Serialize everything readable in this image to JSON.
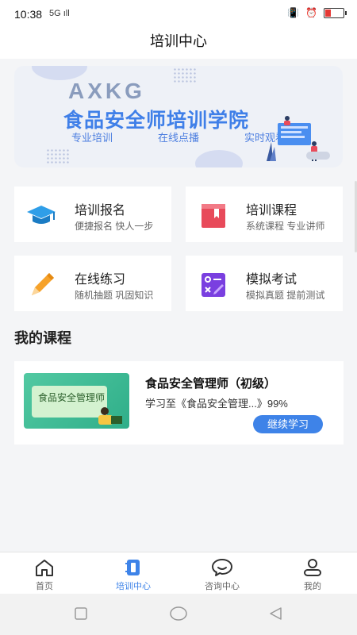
{
  "status_bar": {
    "time": "10:38",
    "signal": "5G ıll"
  },
  "header": {
    "title": "培训中心"
  },
  "banner": {
    "logo": "AXKG",
    "title": "食品安全师培训学院",
    "tags": [
      "专业培训",
      "在线点播",
      "实时观看"
    ]
  },
  "menu": [
    {
      "title": "培训报名",
      "subtitle": "便捷报名 快人一步",
      "icon": "graduation-cap-icon",
      "color": "#2f9ee8"
    },
    {
      "title": "培训课程",
      "subtitle": "系统课程 专业讲师",
      "icon": "book-icon",
      "color": "#e84a5a"
    },
    {
      "title": "在线练习",
      "subtitle": "随机抽题 巩固知识",
      "icon": "pencil-icon",
      "color": "#f6a22a"
    },
    {
      "title": "模拟考试",
      "subtitle": "模拟真题 提前测试",
      "icon": "exam-icon",
      "color": "#7a3fe0"
    }
  ],
  "my_courses": {
    "heading": "我的课程",
    "items": [
      {
        "thumb_text": "食品安全管理师",
        "title": "食品安全管理师（初级）",
        "progress_text": "学习至《食品安全管理...》99%",
        "button": "继续学习"
      }
    ]
  },
  "tabbar": [
    {
      "label": "首页",
      "icon": "home-icon",
      "active": false
    },
    {
      "label": "培训中心",
      "icon": "training-icon",
      "active": true
    },
    {
      "label": "咨询中心",
      "icon": "chat-icon",
      "active": false
    },
    {
      "label": "我的",
      "icon": "user-icon",
      "active": false
    }
  ],
  "colors": {
    "accent": "#3e83e8",
    "background": "#f4f5f7"
  }
}
